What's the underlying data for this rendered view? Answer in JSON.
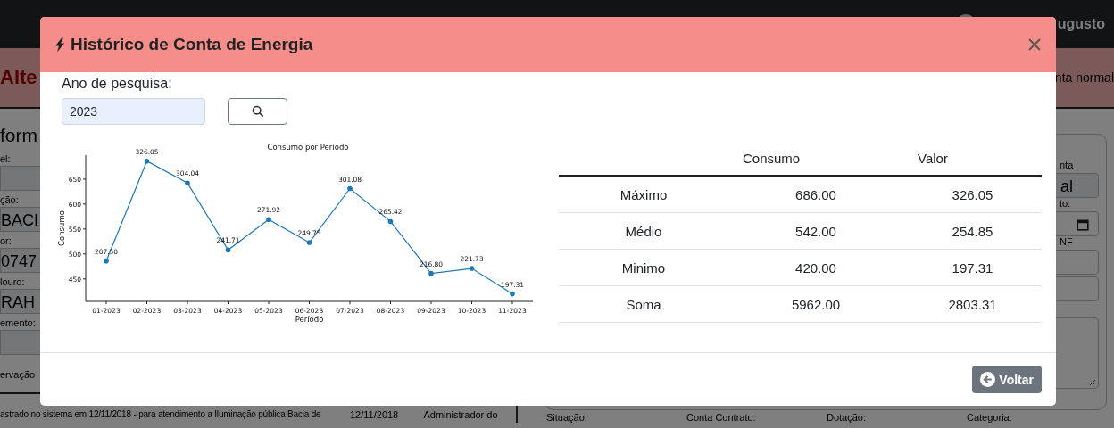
{
  "navbar": {
    "user": "ugusto"
  },
  "page_header": {
    "title": "Alte",
    "status": "nta normal"
  },
  "left_panel": {
    "heading": "form",
    "fields": [
      {
        "label": "el:"
      },
      {
        "label": "ção:",
        "value": "BACI"
      },
      {
        "label": "or:",
        "value": "0747"
      },
      {
        "label": "louro:",
        "value": "RAH"
      },
      {
        "label": "emento:"
      }
    ],
    "observation_label": "ervação",
    "history_row": {
      "text": "astrado no sistema em 12/11/2018 - para atendimento a Iluminação pública Bacia de",
      "date": "12/11/2018",
      "user": "Administrador do"
    }
  },
  "right_panel": {
    "fields": [
      {
        "label": "nta",
        "value": "al",
        "kind": "select"
      },
      {
        "label": "to:",
        "kind": "date"
      },
      {
        "label": "NF",
        "kind": "text"
      },
      {
        "kind": "text"
      },
      {
        "kind": "textarea"
      }
    ],
    "bottom_labels": [
      "Situação:",
      "Conta Contrato:",
      "Dotação:",
      "Categoria:"
    ]
  },
  "modal": {
    "title": "Histórico de Conta de Energia",
    "search": {
      "label": "Ano de pesquisa:",
      "value": "2023"
    },
    "chart_data": {
      "type": "line",
      "title": "Consumo por Período",
      "xlabel": "Período",
      "ylabel": "Consumo",
      "categories": [
        "01-2023",
        "02-2023",
        "03-2023",
        "04-2023",
        "05-2023",
        "06-2023",
        "07-2023",
        "08-2023",
        "09-2023",
        "10-2023",
        "11-2023"
      ],
      "series": [
        {
          "color": "#1f77b4",
          "values": [
            486,
            686,
            642,
            508,
            569,
            523,
            631,
            565,
            461,
            471,
            420
          ]
        }
      ],
      "ylim": [
        405,
        698
      ],
      "yticks": [
        450,
        500,
        550,
        600,
        650
      ],
      "value_labels": [
        "207.50",
        "326.05",
        "304.04",
        "241.71",
        "271.92",
        "249.75",
        "301.08",
        "265.42",
        "216.80",
        "221.73",
        "197.31"
      ]
    },
    "summary_table": {
      "columns": [
        "Consumo",
        "Valor"
      ],
      "rows": [
        {
          "label": "Máximo",
          "consumo": "686.00",
          "valor": "326.05"
        },
        {
          "label": "Médio",
          "consumo": "542.00",
          "valor": "254.85"
        },
        {
          "label": "Minimo",
          "consumo": "420.00",
          "valor": "197.31"
        },
        {
          "label": "Soma",
          "consumo": "5962.00",
          "valor": "2803.31"
        }
      ]
    },
    "back_button": "Voltar"
  }
}
